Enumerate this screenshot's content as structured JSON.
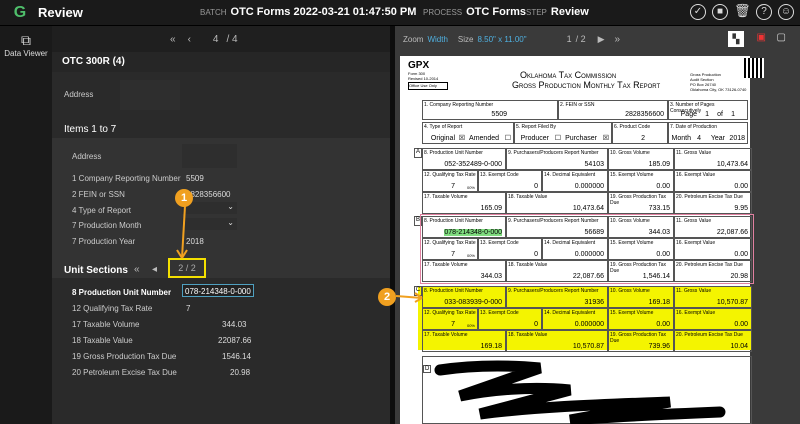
{
  "header": {
    "app": "Review",
    "batch_label": "BATCH",
    "batch": "OTC Forms 2022-03-21 01:47:50 PM",
    "process_label": "PROCESS",
    "process": "OTC Forms",
    "step_label": "STEP",
    "step": "Review"
  },
  "sidebar": {
    "label": "Data Viewer"
  },
  "left": {
    "nav_page": "4",
    "nav_total": "/ 4",
    "form_title": "OTC 300R (4)",
    "address_label": "Address",
    "items_title": "Items 1 to 7",
    "items": [
      {
        "label": "Address",
        "value": ""
      },
      {
        "label": "1 Company Reporting Number",
        "value": "5509"
      },
      {
        "label": "2 FEIN or SSN",
        "value": "2828356600"
      },
      {
        "label": "4 Type of Report",
        "value": ""
      },
      {
        "label": "7 Production Month",
        "value": ""
      },
      {
        "label": "7 Production Year",
        "value": "2018"
      }
    ],
    "unit_sections_title": "Unit Sections",
    "unit_page": "2 / 2",
    "unit_items": [
      {
        "label": "8 Production Unit Number",
        "value": "078-214348-0-000"
      },
      {
        "label": "12 Qualifying Tax Rate",
        "value": "7"
      },
      {
        "label": "17 Taxable Volume",
        "value": "344.03"
      },
      {
        "label": "18 Taxable Value",
        "value": "22087.66"
      },
      {
        "label": "19 Gross Production Tax Due",
        "value": "1546.14"
      },
      {
        "label": "20 Petroleum Excise Tax Due",
        "value": "20.98"
      }
    ]
  },
  "right": {
    "zoom_label": "Zoom",
    "zoom": "Width",
    "size_label": "Size",
    "size": "8.50\" x 11.00\"",
    "page": "1",
    "page_total": "/ 2"
  },
  "doc": {
    "gpx": "GPX",
    "form_no": "Form 300",
    "revised": "Revised 10-2014",
    "office": "Office Use Only",
    "title1": "Oklahoma Tax Commission",
    "title2": "Gross Production Monthly Tax Report",
    "addr": [
      "Gross Production",
      "Audit Section",
      "PO Box 26740",
      "Oklahoma City, OK 73126-0740"
    ],
    "f1": "1. Company Reporting Number",
    "v1": "5509",
    "f2": "2. FEIN or SSN",
    "v2": "2828356600",
    "f3": "3. Number of Pages Consecutively",
    "v3a": "1",
    "v3b": "1",
    "page_word": "Page",
    "of_word": "of",
    "f4": "4. Type of Report",
    "original": "Original",
    "amended": "Amended",
    "f5": "5. Report Filed By",
    "producer": "Producer",
    "purchaser": "Purchaser",
    "f6": "6. Product Code",
    "v6": "2",
    "f7": "7. Date of Production",
    "month_word": "Month",
    "v7m": "4",
    "year_word": "Year",
    "v7y": "2018",
    "sections": [
      {
        "letter": "A",
        "pun": "052-352489-0-000",
        "prn": "54103",
        "gv": "185.09",
        "gval": "10,473.64",
        "qtr": "7",
        "ec": "0",
        "de": "0.000000",
        "ev": "0.00",
        "exv": "0.00",
        "tv": "165.09",
        "tval": "10,473.64",
        "gptd": "733.15",
        "petd": "9.95"
      },
      {
        "letter": "B",
        "pun": "078-214348-0-000",
        "prn": "56689",
        "gv": "344.03",
        "gval": "22,087.66",
        "qtr": "7",
        "ec": "0",
        "de": "0.000000",
        "ev": "0.00",
        "exv": "0.00",
        "tv": "344.03",
        "tval": "22,087.66",
        "gptd": "1,546.14",
        "petd": "20.98"
      },
      {
        "letter": "C",
        "pun": "033-083939-0-000",
        "prn": "31936",
        "gv": "169.18",
        "gval": "10,570.87",
        "qtr": "7",
        "ec": "0",
        "de": "0.000000",
        "ev": "0.00",
        "exv": "0.00",
        "tv": "169.18",
        "tval": "10,570.87",
        "gptd": "739.96",
        "petd": "10.04"
      }
    ],
    "labels": {
      "pun": "8. Production Unit Number",
      "prn": "9. Purchasers/Producers Report Number",
      "gv": "10. Gross Volume",
      "gval": "11. Gross Value",
      "qtr": "12. Qualifying Tax Rate",
      "ec": "13. Exempt Code",
      "de": "14. Decimal Equivalent",
      "ev": "15. Exempt Volume",
      "exv": "16. Exempt Value",
      "tv": "17. Taxable Volume",
      "tval": "18. Taxable Value",
      "gptd": "19. Gross Production Tax Due",
      "petd": "20. Petroleum Excise Tax Due",
      "pct": "00%"
    }
  },
  "callouts": [
    "1",
    "2"
  ]
}
